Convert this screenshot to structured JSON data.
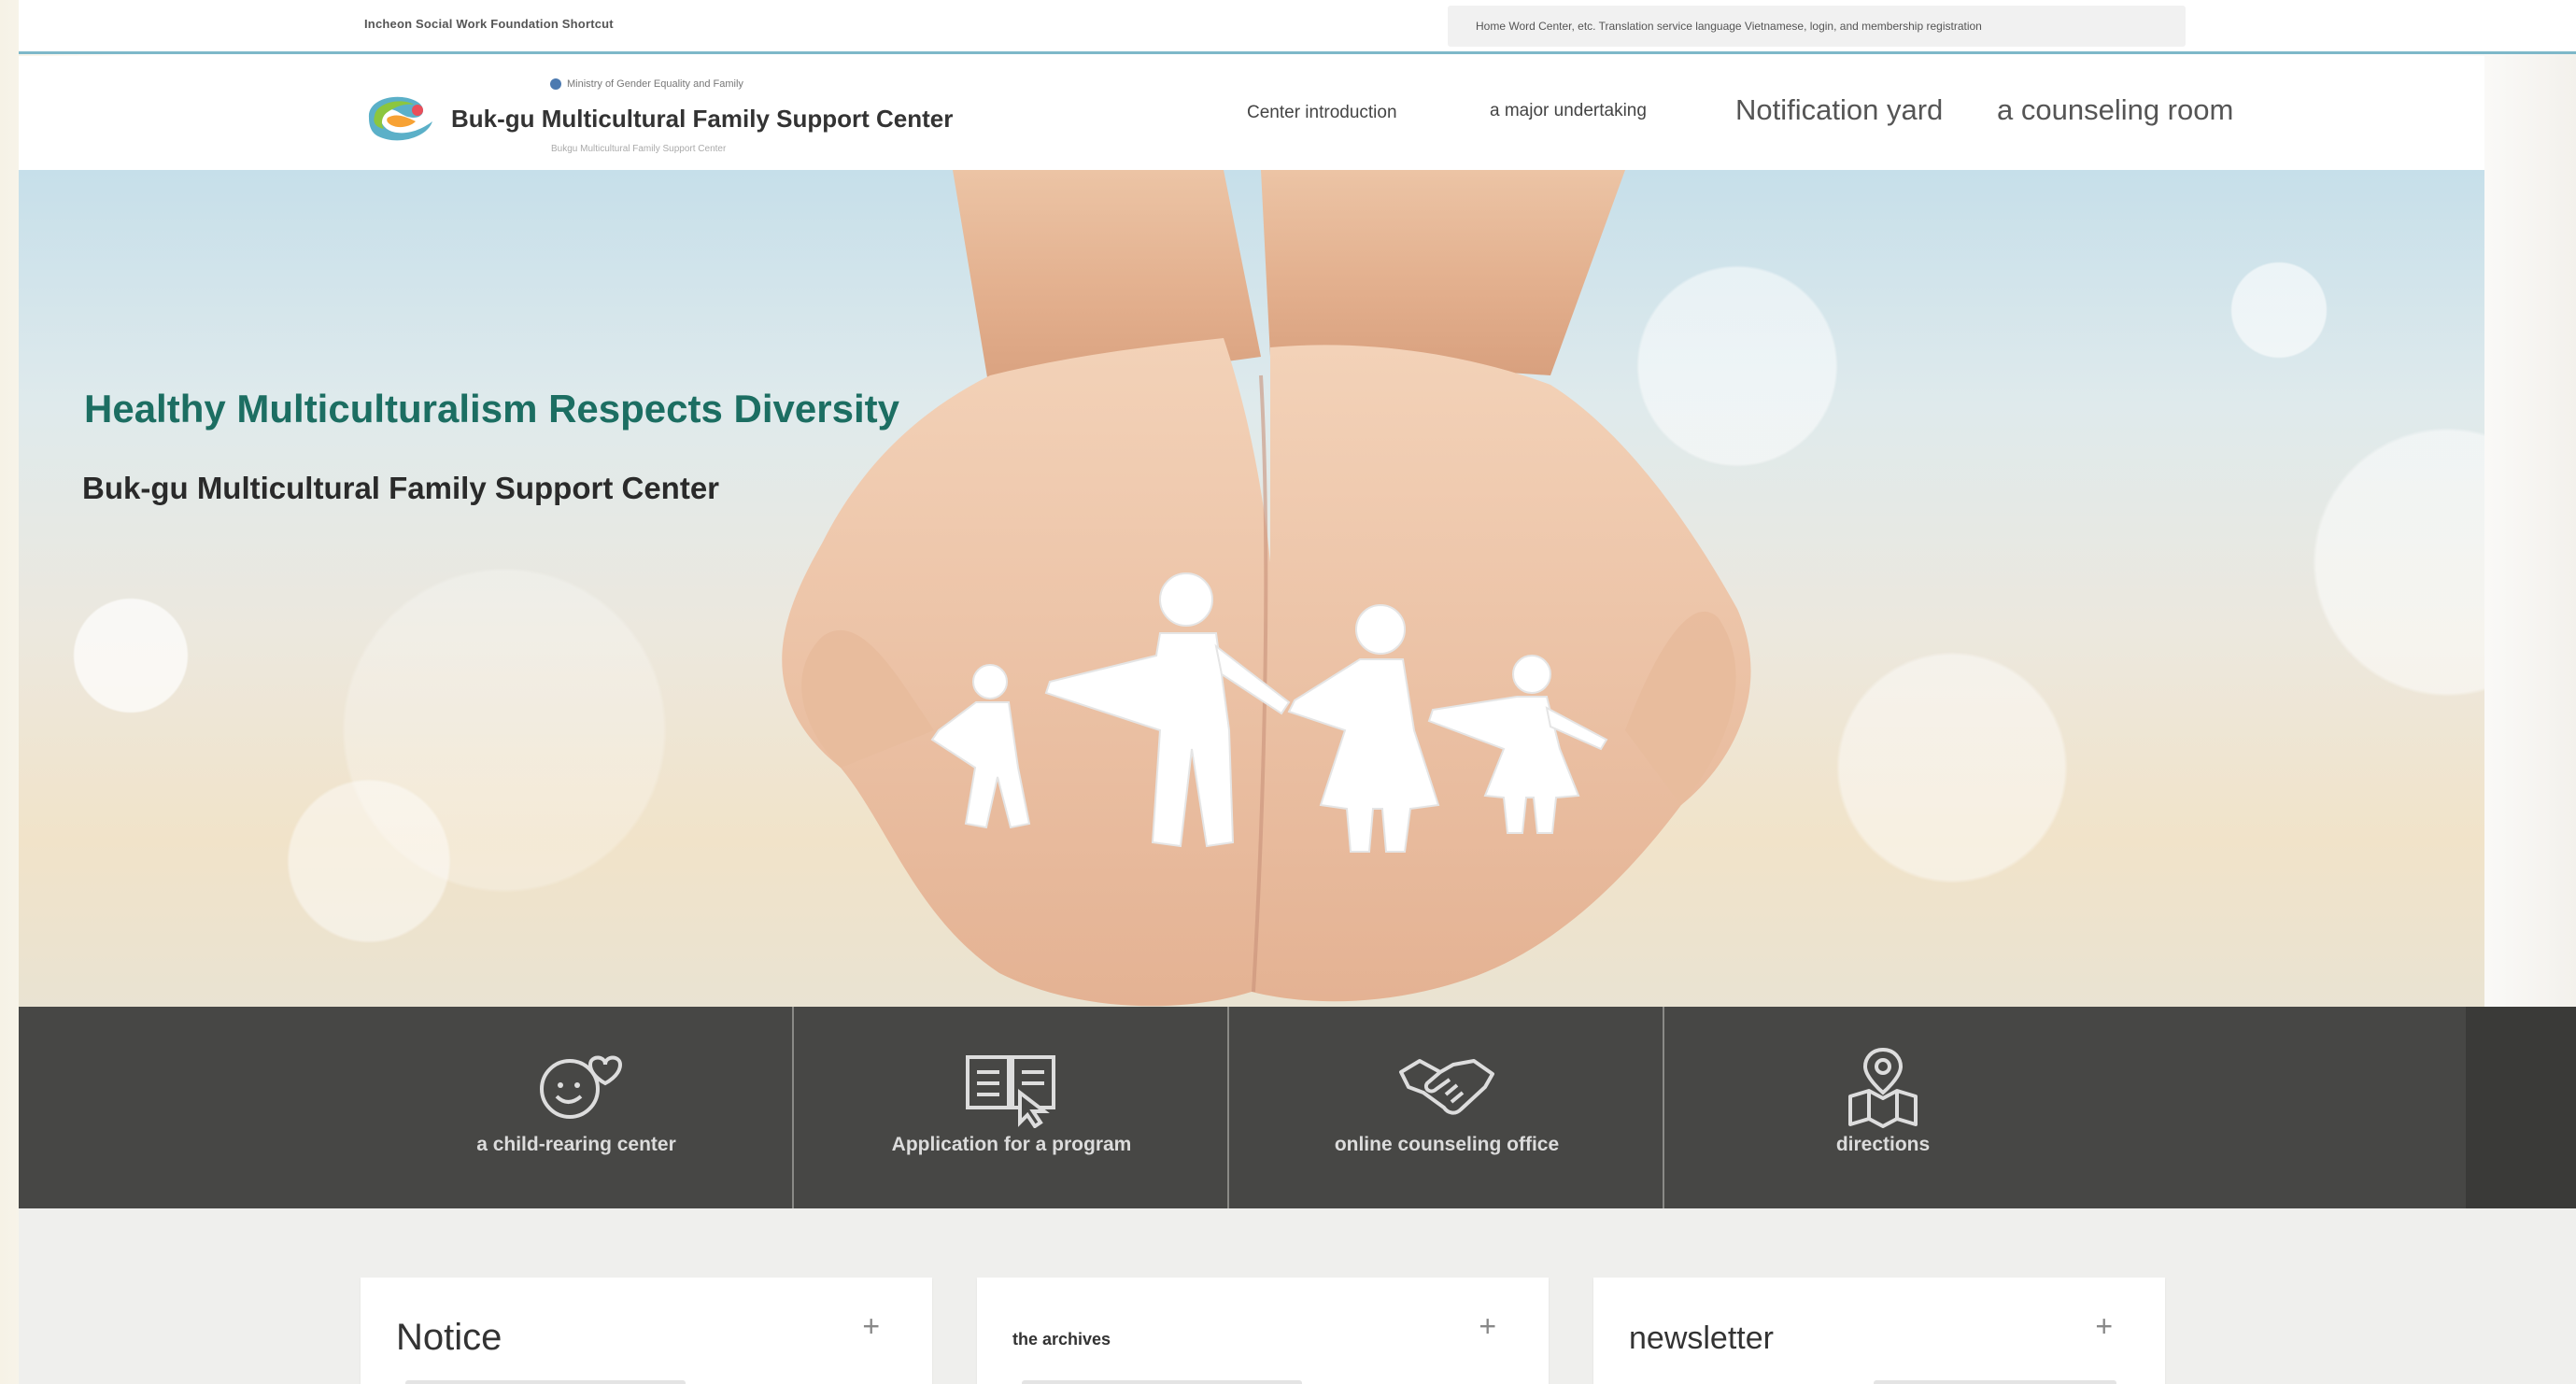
{
  "util_bar": {
    "left_text": "Incheon Social Work Foundation Shortcut",
    "right_text": "Home Word Center, etc. Translation service language Vietnamese, login, and membership registration"
  },
  "header": {
    "logo_org": "Ministry of Gender Equality and Family",
    "logo_title": "Buk-gu Multicultural Family Support Center",
    "logo_sub": "Bukgu Multicultural Family Support Center",
    "nav": [
      {
        "label": "Center introduction"
      },
      {
        "label": "a major undertaking"
      },
      {
        "label": "Notification yard"
      },
      {
        "label": "a counseling room"
      }
    ]
  },
  "hero": {
    "title": "Healthy Multiculturalism Respects Diversity",
    "subtitle": "Buk-gu Multicultural Family Support Center"
  },
  "quick_menu": [
    {
      "label": "a child-rearing center",
      "icon": "smile-heart-icon"
    },
    {
      "label": "Application for a program",
      "icon": "book-pointer-icon"
    },
    {
      "label": "online counseling office",
      "icon": "handshake-icon"
    },
    {
      "label": "directions",
      "icon": "map-pin-icon"
    }
  ],
  "cards": [
    {
      "title": "Notice",
      "plus": "+"
    },
    {
      "title": "the archives",
      "plus": "+"
    },
    {
      "title": "newsletter",
      "plus": "+"
    }
  ],
  "colors": {
    "accent_green": "#1c6e62",
    "quick_bg": "#474745",
    "util_border": "#7eb8c9"
  }
}
